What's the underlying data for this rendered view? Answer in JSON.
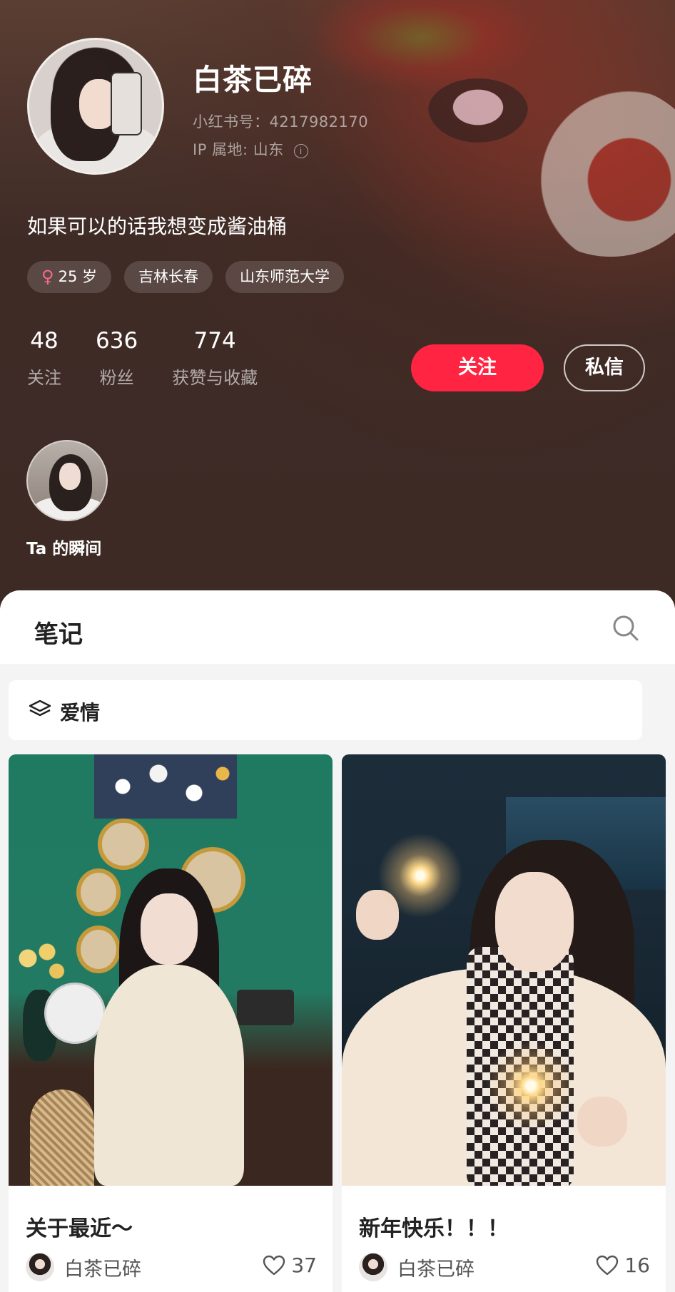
{
  "profile": {
    "username": "白茶已碎",
    "id_line": "小红书号：4217982170",
    "ip_line": "IP 属地: 山东",
    "bio": "如果可以的话我想变成酱油桶",
    "tags": [
      {
        "icon": "female-icon",
        "label": "25 岁"
      },
      {
        "label": "吉林长春"
      },
      {
        "label": "山东师范大学"
      }
    ],
    "stats": [
      {
        "value": "48",
        "label": "关注"
      },
      {
        "value": "636",
        "label": "粉丝"
      },
      {
        "value": "774",
        "label": "获赞与收藏"
      }
    ],
    "follow_label": "关注",
    "message_label": "私信",
    "moments_label": "Ta 的瞬间",
    "colors": {
      "accent": "#ff2442",
      "female": "#f36c8a"
    }
  },
  "notes": {
    "tab_label": "笔记",
    "filter_label": "爱情",
    "cards": [
      {
        "title": "关于最近～",
        "author": "白茶已碎",
        "likes": "37"
      },
      {
        "title": "新年快乐！！！",
        "author": "白茶已碎",
        "likes": "16"
      }
    ]
  }
}
